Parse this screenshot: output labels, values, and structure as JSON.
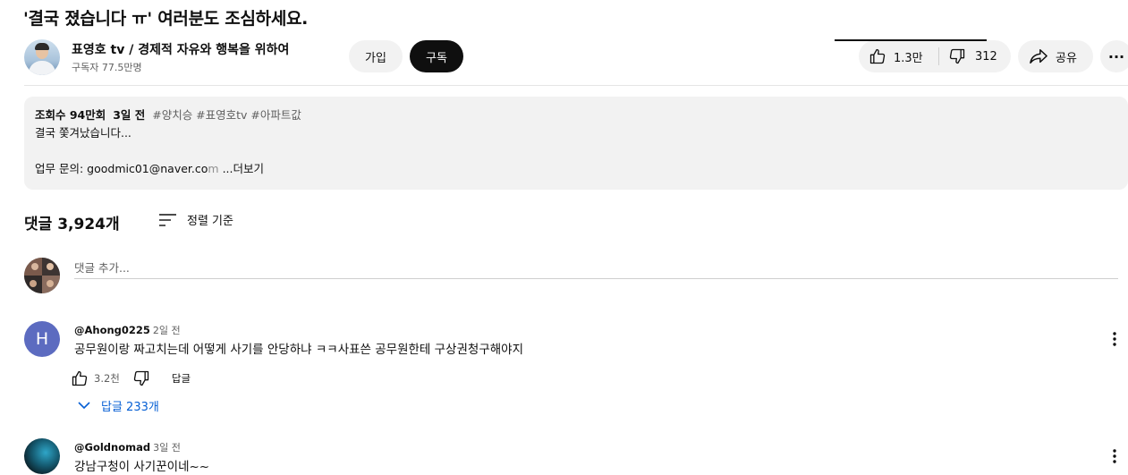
{
  "video": {
    "title": "'결국 졌습니다 ㅠ' 여러분도 조심하세요."
  },
  "channel": {
    "name": "표영호 tv",
    "slogan": " / 경제적 자유와 행복을 위하여",
    "subscribers": "구독자 77.5만명",
    "join_label": "가입",
    "subscribe_label": "구독"
  },
  "actions": {
    "likes": "1.3만",
    "dislikes": "312",
    "share_label": "공유",
    "more_label": "···"
  },
  "description": {
    "views": "조회수 94만회",
    "age": "3일 전",
    "hashtags": "#양치승 #표영호tv #아파트값",
    "line1": "결국 쫓겨났습니다...",
    "contact_prefix": "업무 문의: goodmic01@naver.co",
    "contact_fade": "m",
    "more_label": " ...더보기"
  },
  "comments": {
    "heading": "댓글 3,924개",
    "sort_label": "정렬 기준",
    "add_placeholder": "댓글 추가...",
    "items": [
      {
        "avatar_letter": "H",
        "author": "@Ahong0225",
        "time": "2일 전",
        "text": "공무원이랑 짜고치는데 어떻게 사기를 안당하냐 ㅋㅋ사표쓴 공무원한테 구상권청구해야지",
        "likes": "3.2천",
        "reply_label": "답글",
        "replies_label": "답글 233개"
      },
      {
        "author": "@Goldnomad",
        "time": "3일 전",
        "text": "강남구청이 사기꾼이네~~"
      }
    ]
  },
  "colors": {
    "accent_link": "#065fd4",
    "subscribe_bg": "#0f0f0f",
    "pill_bg": "#f2f2f2",
    "avatar_h": "#5c6bc0"
  }
}
